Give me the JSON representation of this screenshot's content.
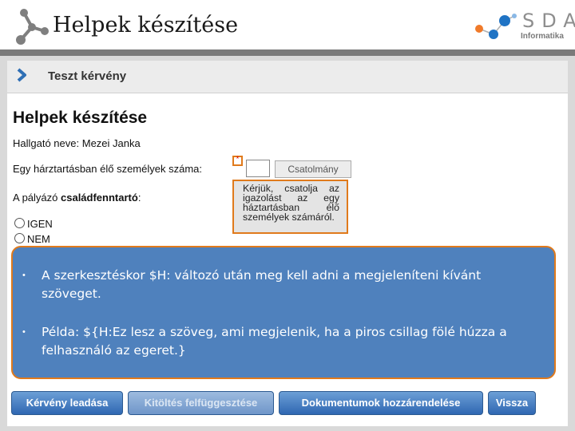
{
  "slide": {
    "title": "Helpek készítése"
  },
  "logo": {
    "letters": "SDA",
    "subtitle": "Informatika"
  },
  "window": {
    "title": "Teszt kérvény"
  },
  "form": {
    "heading": "Helpek készítése",
    "student_label": "Hallgató neve:",
    "student_value": "Mezei Janka",
    "household_label": "Egy hárztartásban élő személyek száma:",
    "household_value": "",
    "attach_label": "Csatolmány",
    "help_marker": "*",
    "tooltip_text": "Kérjük, csatolja az igazolást az egy háztartásban élő személyek számáról.",
    "breadwinner_label_prefix": "A pályázó ",
    "breadwinner_label_bold": "családfenntartó",
    "breadwinner_label_suffix": ":",
    "options": [
      "IGEN",
      "NEM"
    ]
  },
  "callout": {
    "bullets": [
      "A szerkesztéskor $H: változó után meg kell adni a megjeleníteni kívánt szöveget.",
      "Példa: ${H:Ez lesz a szöveg, ami megjelenik, ha a piros csillag fölé húzza a felhasználó az egeret.}"
    ]
  },
  "actions": {
    "submit": "Kérvény leadása",
    "suspend": "Kitöltés felfüggesztése",
    "documents": "Dokumentumok hozzárendelése",
    "back": "Vissza"
  },
  "colors": {
    "callout_fill": "#4f81bd",
    "accent_border": "#e07a1c",
    "button_blue": "#3a72b8",
    "logo_orange": "#f07a2a"
  }
}
